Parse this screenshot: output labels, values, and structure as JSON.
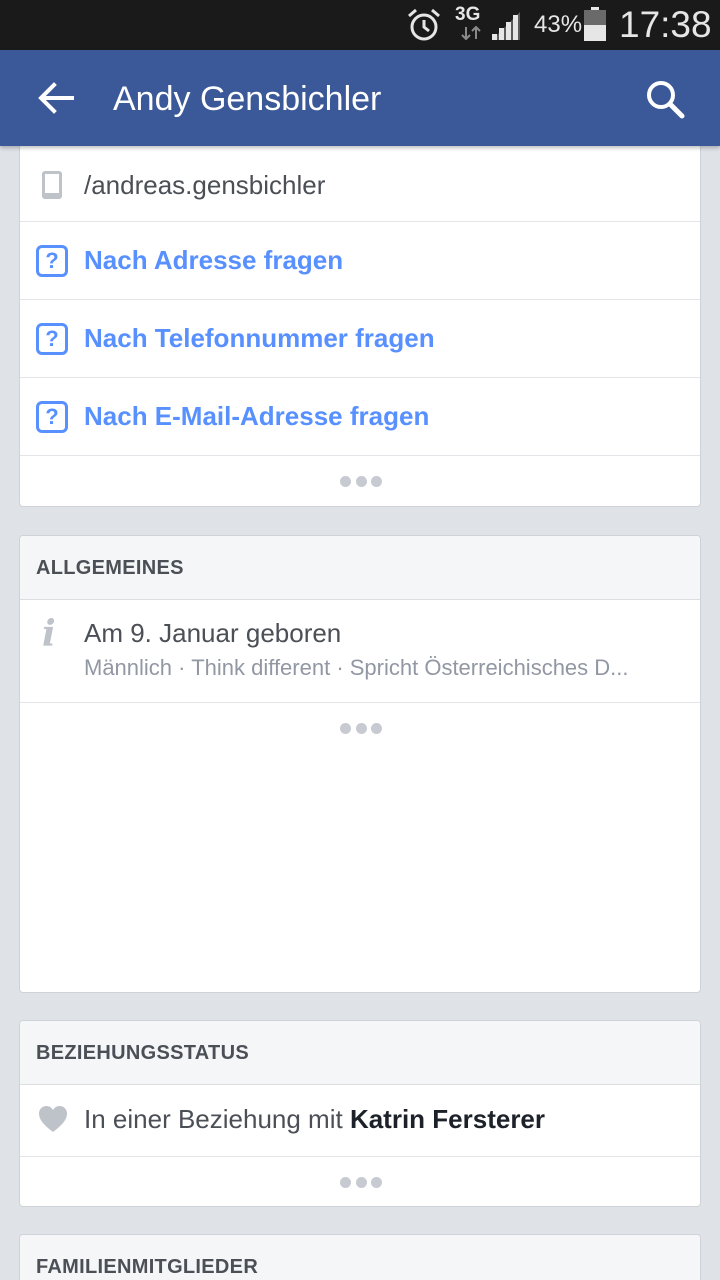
{
  "status_bar": {
    "network": "3G",
    "battery": "43%",
    "time": "17:38",
    "icons": [
      "alarm-icon",
      "network-arrows-icon",
      "signal-icon",
      "battery-icon"
    ]
  },
  "app_bar": {
    "title": "Andy Gensbichler",
    "back_icon": "arrow-left-icon",
    "search_icon": "search-icon",
    "color": "#3b5998"
  },
  "contact_card": {
    "profile_handle": "/andreas.gensbichler",
    "ask_items": [
      "Nach Adresse fragen",
      "Nach Telefonnummer fragen",
      "Nach E-Mail-Adresse fragen"
    ],
    "link_color": "#5890ff"
  },
  "general": {
    "heading": "ALLGEMEINES",
    "birthday": "Am 9. Januar geboren",
    "details": "Männlich · Think different · Spricht Österreichisches D..."
  },
  "relationship": {
    "heading": "BEZIEHUNGSSTATUS",
    "prefix": "In einer Beziehung mit ",
    "partner": "Katrin Fersterer"
  },
  "family": {
    "heading": "FAMILIENMITGLIEDER"
  }
}
